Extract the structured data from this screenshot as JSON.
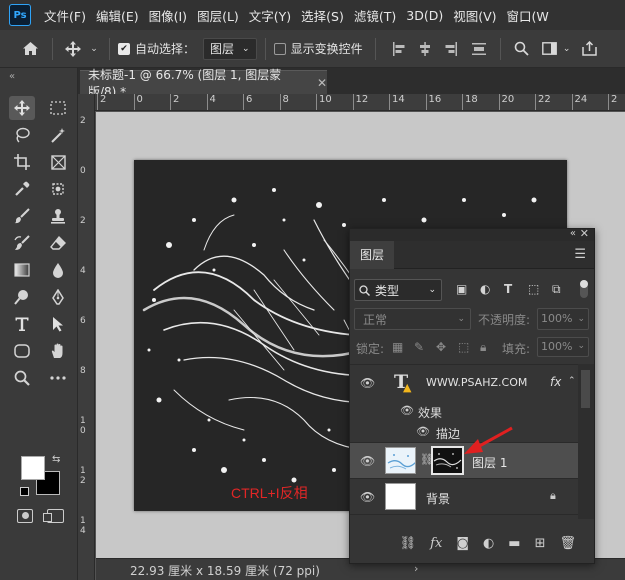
{
  "menubar": {
    "app_icon": "Ps",
    "items": [
      "文件(F)",
      "编辑(E)",
      "图像(I)",
      "图层(L)",
      "文字(Y)",
      "选择(S)",
      "滤镜(T)",
      "3D(D)",
      "视图(V)",
      "窗口(W"
    ]
  },
  "options": {
    "auto_select_label": "自动选择：",
    "auto_select_checked": true,
    "auto_select_target": "图层",
    "show_transform_label": "显示变换控件",
    "show_transform_checked": false
  },
  "document": {
    "tab_title": "未标题-1 @ 66.7% (图层 1, 图层蒙版/8) *",
    "overlay_text": "CTRL+I反相"
  },
  "ruler": {
    "h_ticks": [
      "2",
      "0",
      "2",
      "4",
      "6",
      "8",
      "10",
      "12",
      "14",
      "16",
      "18",
      "20",
      "22",
      "24",
      "2"
    ]
  },
  "status": {
    "doc_size": "22.93 厘米 x 18.59 厘米 (72 ppi)"
  },
  "layers_panel": {
    "tab_title": "图层",
    "filter_kind": "类型",
    "blend_mode": "正常",
    "opacity_label": "不透明度:",
    "opacity_value": "100%",
    "lock_label": "锁定:",
    "fill_label": "填充:",
    "fill_value": "100%",
    "layers": [
      {
        "name": "WWW.PSAHZ.COM",
        "type": "text",
        "fx": "fx"
      },
      {
        "name": "效果",
        "type": "effects-group"
      },
      {
        "name": "描边",
        "type": "effect"
      },
      {
        "name": "图层 1",
        "type": "pixel",
        "selected": true
      },
      {
        "name": "背景",
        "type": "background",
        "locked": true
      }
    ]
  },
  "colors": {
    "accent_blue": "#31a8ff",
    "overlay_red": "#e22626",
    "arrow_red": "#e02020",
    "ui_dark": "#323232",
    "canvas_bg": "#c8c8c8"
  },
  "icons": {
    "toolbar": [
      "move-icon",
      "marquee-icon",
      "lasso-icon",
      "magic-wand-icon",
      "crop-icon",
      "frame-icon",
      "eyedropper-icon",
      "patch-icon",
      "brush-icon",
      "clone-stamp-icon",
      "history-brush-icon",
      "eraser-icon",
      "gradient-icon",
      "blur-icon",
      "dodge-icon",
      "pen-icon",
      "type-icon",
      "path-select-icon",
      "shape-icon",
      "hand-icon",
      "zoom-icon",
      "more-icon"
    ]
  }
}
